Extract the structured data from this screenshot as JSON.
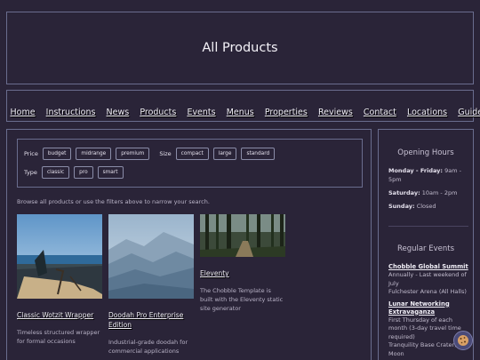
{
  "header": {
    "title": "All Products"
  },
  "nav": [
    "Home",
    "Instructions",
    "News",
    "Products",
    "Events",
    "Menus",
    "Properties",
    "Reviews",
    "Contact",
    "Locations",
    "Guide"
  ],
  "filters": {
    "price_label": "Price",
    "price_options": [
      "budget",
      "midrange",
      "premium"
    ],
    "size_label": "Size",
    "size_options": [
      "compact",
      "large",
      "standard"
    ],
    "type_label": "Type",
    "type_options": [
      "classic",
      "pro",
      "smart"
    ]
  },
  "hint": "Browse all products or use the filters above to narrow your search.",
  "products": [
    {
      "title": "Classic Wotzit Wrapper",
      "desc": "Timeless structured wrapper for formal occasions"
    },
    {
      "title": "Doodah Pro Enterprise Edition",
      "desc": "Industrial-grade doodah for commercial applications"
    },
    {
      "title": "Eleventy",
      "desc": "The Chobble Template is built with the Eleventy static site generator"
    }
  ],
  "sidebar": {
    "hours_title": "Opening Hours",
    "hours": [
      {
        "day": "Monday - Friday:",
        "time": "9am - 5pm"
      },
      {
        "day": "Saturday:",
        "time": "10am - 2pm"
      },
      {
        "day": "Sunday:",
        "time": "Closed"
      }
    ],
    "events_title": "Regular Events",
    "events": [
      {
        "name": "Chobble Global Summit",
        "when": "Annually - Last weekend of July",
        "where": "Fulchester Arena (All Halls)"
      },
      {
        "name": "Lunar Networking Extravaganza",
        "when": "First Thursday of each month (3-day travel time required)",
        "where": "Tranquility Base Crater, The Moon"
      }
    ]
  },
  "icons": {
    "cookie": "cookie-icon"
  },
  "colors": {
    "background": "#2a2438",
    "border": "#6a6d8e"
  }
}
